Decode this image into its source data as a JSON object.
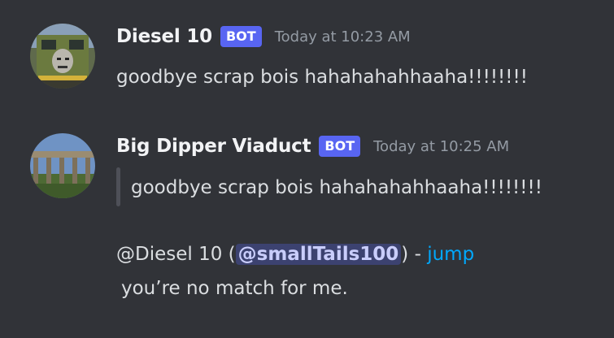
{
  "messages": [
    {
      "username": "Diesel 10",
      "tag": "BOT",
      "timestamp": "Today at 10:23 AM",
      "text": "goodbye scrap bois hahahahahhaaha!!!!!!!!"
    },
    {
      "username": "Big Dipper Viaduct",
      "tag": "BOT",
      "timestamp": "Today at 10:25 AM",
      "quote": "goodbye scrap bois hahahahahhaaha!!!!!!!!",
      "reply_prefix": "@Diesel 10 (",
      "mention": "@smallTails100",
      "reply_suffix": ") - ",
      "link": "jump",
      "body": "you’re no match for me."
    }
  ],
  "colors": {
    "background": "#313338",
    "bot_tag": "#5865f2",
    "link": "#00a8fc",
    "mention_bg": "#3c4270"
  }
}
